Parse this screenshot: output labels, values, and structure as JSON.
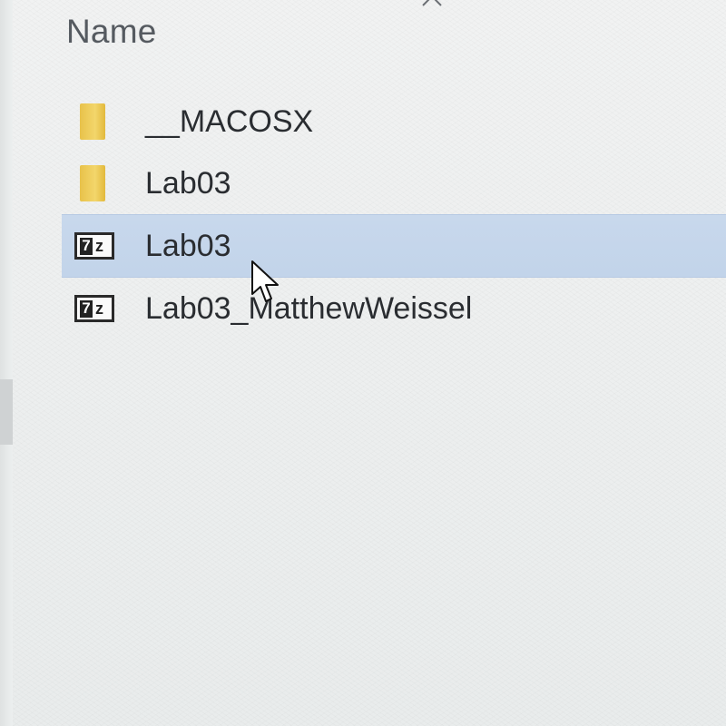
{
  "header": {
    "column_name": "Name",
    "sort_indicator_icon": "chevron-up-icon"
  },
  "files": [
    {
      "name": "__MACOSX",
      "type": "folder",
      "icon": "folder-icon",
      "selected": false
    },
    {
      "name": "Lab03",
      "type": "folder",
      "icon": "folder-icon",
      "selected": false
    },
    {
      "name": "Lab03",
      "type": "7z-archive",
      "icon": "7z-archive-icon",
      "icon_text": "7z",
      "selected": true
    },
    {
      "name": "Lab03_MatthewWeissel",
      "type": "7z-archive",
      "icon": "7z-archive-icon",
      "icon_text": "7z",
      "selected": false
    }
  ],
  "colors": {
    "selection": "#c4d5eb",
    "folder": "#f0cf5c",
    "text": "#2a2d31"
  },
  "cursor_icon": "mouse-pointer-icon"
}
